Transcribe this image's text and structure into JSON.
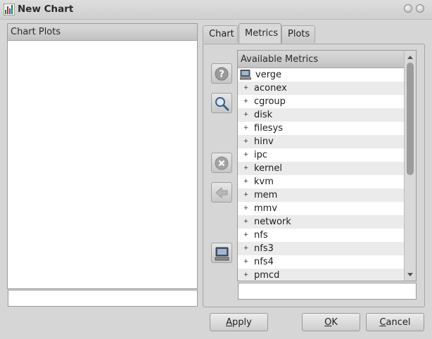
{
  "window": {
    "title": "New Chart",
    "icon": "chart-app-icon",
    "controls": [
      "minimize-icon",
      "close-icon"
    ]
  },
  "left_panel": {
    "header": "Chart Plots",
    "items": [],
    "input_value": ""
  },
  "tabs": [
    {
      "label": "Chart",
      "active": false
    },
    {
      "label": "Metrics",
      "active": true
    },
    {
      "label": "Plots",
      "active": false
    }
  ],
  "side_buttons": [
    {
      "icon": "help-icon"
    },
    {
      "icon": "search-icon"
    },
    {
      "icon": "delete-icon"
    },
    {
      "icon": "arrow-left-icon"
    },
    {
      "icon": "host-icon"
    }
  ],
  "metrics_tree": {
    "header": "Available Metrics",
    "root": {
      "label": "verge",
      "icon": "host-icon"
    },
    "items": [
      {
        "label": "aconex",
        "expander": "+"
      },
      {
        "label": "cgroup",
        "expander": "+"
      },
      {
        "label": "disk",
        "expander": "+"
      },
      {
        "label": "filesys",
        "expander": "+"
      },
      {
        "label": "hinv",
        "expander": "+"
      },
      {
        "label": "ipc",
        "expander": "+"
      },
      {
        "label": "kernel",
        "expander": "+"
      },
      {
        "label": "kvm",
        "expander": "+"
      },
      {
        "label": "mem",
        "expander": "+"
      },
      {
        "label": "mmv",
        "expander": "+"
      },
      {
        "label": "network",
        "expander": "+"
      },
      {
        "label": "nfs",
        "expander": "+"
      },
      {
        "label": "nfs3",
        "expander": "+"
      },
      {
        "label": "nfs4",
        "expander": "+"
      },
      {
        "label": "pmcd",
        "expander": "+"
      }
    ],
    "input_value": ""
  },
  "buttons": {
    "apply": {
      "mnemonic": "A",
      "rest": "pply"
    },
    "ok": {
      "mnemonic": "O",
      "rest": "K"
    },
    "cancel": {
      "mnemonic": "C",
      "rest": "ancel"
    }
  },
  "colors": {
    "window_bg": "#d6d6d6",
    "header_bg": "#c8c8c8",
    "alt_row": "#ebebeb"
  }
}
